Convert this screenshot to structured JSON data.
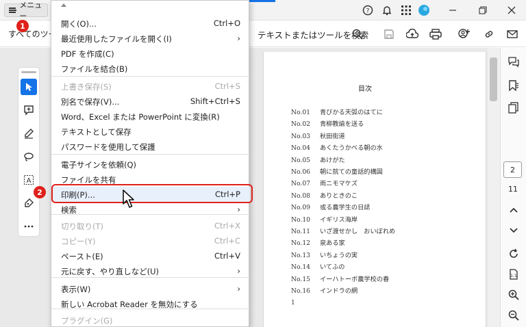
{
  "titlebar": {
    "menu_label": "メニュー"
  },
  "toolbar": {
    "tools_label": "すべてのツー",
    "search_label": "テキストまたはツールを検索"
  },
  "menu": {
    "items": [
      {
        "label": "開く(O)...",
        "shortcut": "Ctrl+O"
      },
      {
        "label": "最近使用したファイルを開く(I)",
        "shortcut": "›"
      },
      {
        "label": "PDF を作成(C)",
        "shortcut": ""
      },
      {
        "label": "ファイルを結合(B)",
        "shortcut": ""
      },
      {
        "label": "上書き保存(S)",
        "shortcut": "Ctrl+S"
      },
      {
        "label": "別名で保存(V)...",
        "shortcut": "Shift+Ctrl+S"
      },
      {
        "label": "Word、Excel または PowerPoint に変換(R)",
        "shortcut": ""
      },
      {
        "label": "テキストとして保存",
        "shortcut": ""
      },
      {
        "label": "パスワードを使用して保護",
        "shortcut": ""
      },
      {
        "label": "電子サインを依頼(Q)",
        "shortcut": ""
      },
      {
        "label": "ファイルを共有",
        "shortcut": ""
      },
      {
        "label": "印刷(P)...",
        "shortcut": "Ctrl+P"
      },
      {
        "label": "検索",
        "shortcut": "›"
      },
      {
        "label": "切り取り(T)",
        "shortcut": "Ctrl+X"
      },
      {
        "label": "コピー(Y)",
        "shortcut": "Ctrl+C"
      },
      {
        "label": "ペースト(E)",
        "shortcut": "Ctrl+V"
      },
      {
        "label": "元に戻す、やり直しなど(U)",
        "shortcut": "›"
      },
      {
        "label": "表示(W)",
        "shortcut": "›"
      },
      {
        "label": "新しい Acrobat Reader を無効にする",
        "shortcut": ""
      },
      {
        "label": "プラグイン(G)",
        "shortcut": ""
      }
    ]
  },
  "annotations": {
    "badge1": "1",
    "badge2": "2"
  },
  "document": {
    "title": "目次",
    "toc": [
      {
        "no": "No.01",
        "title": "青びかる天弧のはてに"
      },
      {
        "no": "No.02",
        "title": "青柳教諭を送る"
      },
      {
        "no": "No.03",
        "title": "秋田街道"
      },
      {
        "no": "No.04",
        "title": "あくたうかべる朝の水"
      },
      {
        "no": "No.05",
        "title": "あけがた"
      },
      {
        "no": "No.06",
        "title": "朝に就ての童話的構図"
      },
      {
        "no": "No.07",
        "title": "雨ニモマケズ"
      },
      {
        "no": "No.08",
        "title": "ありときのこ"
      },
      {
        "no": "No.09",
        "title": "或る農学生の日誌"
      },
      {
        "no": "No.10",
        "title": "イギリス海岸"
      },
      {
        "no": "No.11",
        "title": "いざ渡せかし　おいぼれめ"
      },
      {
        "no": "No.12",
        "title": "泉ある家"
      },
      {
        "no": "No.13",
        "title": "いちょうの実"
      },
      {
        "no": "No.14",
        "title": "いてふの"
      },
      {
        "no": "No.15",
        "title": "イーハトーボ農学校の春"
      },
      {
        "no": "No.16",
        "title": "インドラの網"
      }
    ],
    "page_footer": "1"
  },
  "navigation": {
    "current_page": "2",
    "total_pages": "11"
  },
  "colors": {
    "accent": "#1473e6",
    "highlight": "#e0201b"
  }
}
